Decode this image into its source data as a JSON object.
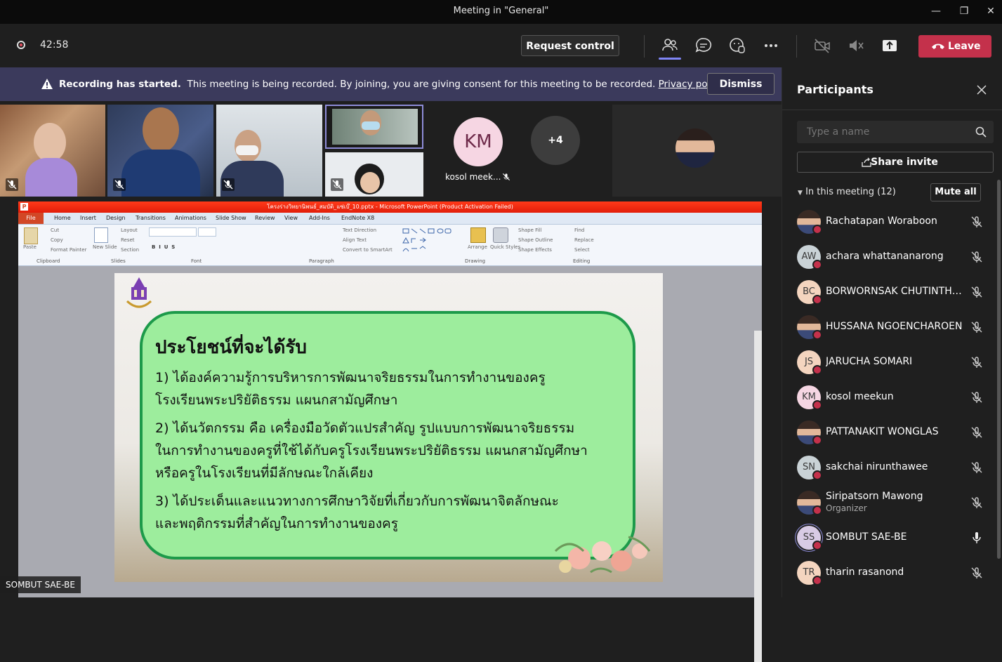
{
  "window": {
    "title": "Meeting in \"General\""
  },
  "toolbar": {
    "timer": "42:58",
    "request_control": "Request control",
    "leave": "Leave"
  },
  "banner": {
    "bold": "Recording has started.",
    "text": "This meeting is being recorded. By joining, you are giving consent for this meeting to be recorded.",
    "link": "Privacy policy",
    "dismiss": "Dismiss"
  },
  "video": {
    "km_initials": "KM",
    "km_name": "kosol meek...",
    "more": "+4"
  },
  "panel": {
    "title": "Participants",
    "search_placeholder": "Type a name",
    "share_invite": "Share invite",
    "in_meeting": "In this meeting (12)",
    "mute_all": "Mute all",
    "participants": [
      {
        "initials": "",
        "name": "Rachatapan Woraboon",
        "role": "",
        "photo": true,
        "mic": "off"
      },
      {
        "initials": "AW",
        "name": "achara whattananarong",
        "role": "",
        "photo": false,
        "color": "#c9d2d6",
        "mic": "off"
      },
      {
        "initials": "BC",
        "name": "BORWORNSAK CHUTINTHAR...",
        "role": "",
        "photo": false,
        "color": "#f4d5bf",
        "mic": "off"
      },
      {
        "initials": "",
        "name": "HUSSANA NGOENCHAROEN",
        "role": "",
        "photo": true,
        "mic": "off"
      },
      {
        "initials": "JS",
        "name": "JARUCHA SOMARI",
        "role": "",
        "photo": false,
        "color": "#f4d5bf",
        "mic": "off"
      },
      {
        "initials": "KM",
        "name": "kosol meekun",
        "role": "",
        "photo": false,
        "color": "#f6d6e3",
        "mic": "off"
      },
      {
        "initials": "",
        "name": "PATTANAKIT WONGLAS",
        "role": "",
        "photo": true,
        "mic": "off"
      },
      {
        "initials": "SN",
        "name": "sakchai nirunthawee",
        "role": "",
        "photo": false,
        "color": "#c9d2d6",
        "mic": "off"
      },
      {
        "initials": "",
        "name": "Siripatsorn Mawong",
        "role": "Organizer",
        "photo": true,
        "mic": "off"
      },
      {
        "initials": "SS",
        "name": "SOMBUT SAE-BE",
        "role": "",
        "photo": false,
        "color": "#d8cbe5",
        "mic": "on"
      },
      {
        "initials": "TR",
        "name": "tharin rasanond",
        "role": "",
        "photo": false,
        "color": "#f4d5bf",
        "mic": "off"
      }
    ]
  },
  "ppt": {
    "title": "โครงร่างวิทยานิพนธ์_สมบัติ_แซ่เบ๊_10.pptx - Microsoft PowerPoint (Product Activation Failed)",
    "file_tab": "File",
    "tabs": [
      "Home",
      "Insert",
      "Design",
      "Transitions",
      "Animations",
      "Slide Show",
      "Review",
      "View",
      "Add-Ins",
      "EndNote X8"
    ],
    "groups": [
      "Clipboard",
      "Slides",
      "Font",
      "Paragraph",
      "Drawing",
      "Editing"
    ],
    "ribbon_labels": {
      "paste": "Paste",
      "cut": "Cut",
      "copy": "Copy",
      "format_painter": "Format Painter",
      "new_slide": "New Slide",
      "layout": "Layout",
      "reset": "Reset",
      "section": "Section",
      "text_direction": "Text Direction",
      "align_text": "Align Text",
      "convert": "Convert to SmartArt",
      "arrange": "Arrange",
      "quick_styles": "Quick Styles",
      "shape_fill": "Shape Fill",
      "shape_outline": "Shape Outline",
      "shape_effects": "Shape Effects",
      "find": "Find",
      "replace": "Replace",
      "select": "Select"
    }
  },
  "slide": {
    "heading": "ประโยชน์ที่จะได้รับ",
    "lines": [
      "1) ได้องค์ความรู้การบริหารการพัฒนาจริยธรรมในการทำงานของครู",
      "โรงเรียนพระปริยัติธรรม แผนกสามัญศึกษา",
      "2) ได้นวัตกรรม คือ เครื่องมือวัดตัวแปรสำคัญ รูปแบบการพัฒนาจริยธรรม",
      "ในการทำงานของครูที่ใช้ได้กับครูโรงเรียนพระปริยัติธรรม แผนกสามัญศึกษา",
      "หรือครูในโรงเรียนที่มีลักษณะใกล้เคียง",
      "3) ได้ประเด็นและแนวทางการศึกษาวิจัยที่เกี่ยวกับการพัฒนาจิตลักษณะ",
      "และพฤติกรรมที่สำคัญในการทำงานของครู"
    ]
  },
  "presenter": {
    "name": "SOMBUT SAE-BE"
  },
  "colors": {
    "accent": "#6264a7",
    "leave": "#c4314b",
    "banner": "#3b3a5c",
    "slide_box": "#9ded9d",
    "slide_border": "#1d9a4a"
  }
}
